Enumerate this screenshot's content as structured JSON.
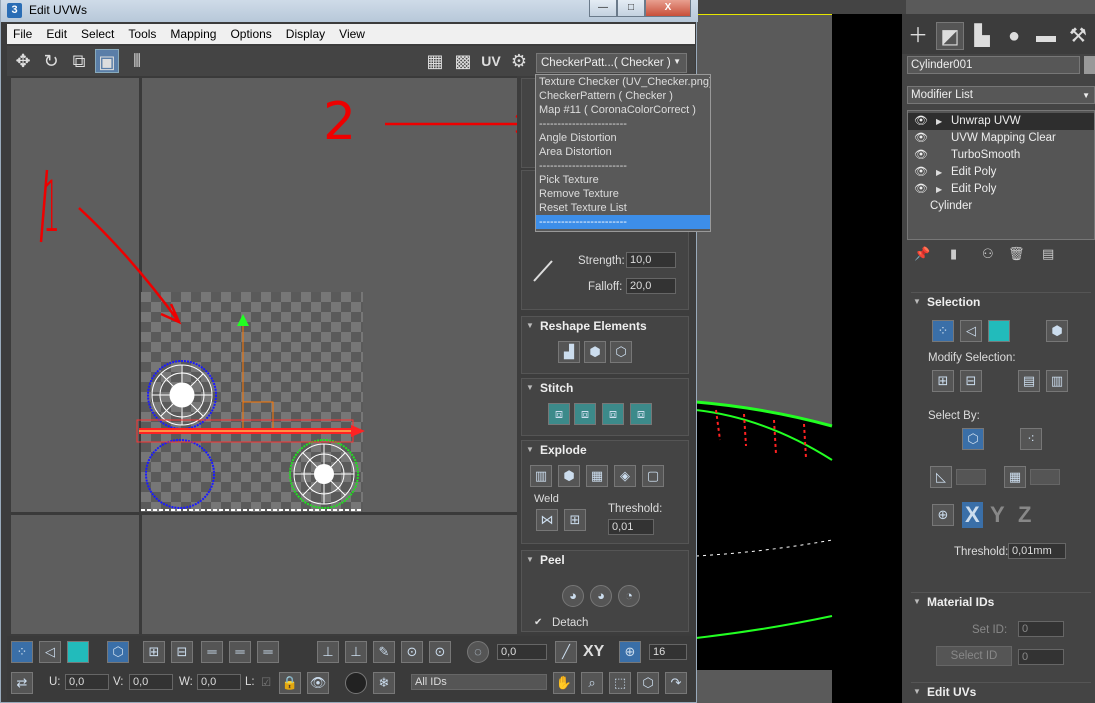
{
  "window": {
    "title": "Edit UVWs",
    "app_icon": "3",
    "controls": {
      "minimize": "—",
      "maximize": "□",
      "close": "X"
    }
  },
  "menu": [
    "File",
    "Edit",
    "Select",
    "Tools",
    "Mapping",
    "Options",
    "Display",
    "View"
  ],
  "toolbar": {
    "uv_label": "UV",
    "texture_dropdown": "CheckerPatt...( Checker )"
  },
  "texture_list": {
    "items": [
      "Texture Checker (UV_Checker.png)",
      "CheckerPattern  ( Checker )",
      "Map #11  ( CoronaColorCorrect )",
      "------------------------",
      "Angle Distortion",
      "Area Distortion",
      "------------------------",
      "Pick Texture",
      "Remove Texture",
      "Reset Texture List",
      "------------------------"
    ]
  },
  "annotations": {
    "one": "1",
    "two": "2"
  },
  "rollouts": {
    "soft": {
      "strength_label": "Strength:",
      "strength_value": "10,0",
      "falloff_label": "Falloff:",
      "falloff_value": "20,0"
    },
    "reshape": {
      "title": "Reshape Elements"
    },
    "stitch": {
      "title": "Stitch"
    },
    "explode": {
      "title": "Explode",
      "weld_label": "Weld",
      "threshold_label": "Threshold:",
      "threshold_value": "0,01"
    },
    "peel": {
      "title": "Peel",
      "detach_label": "Detach"
    }
  },
  "bottom": {
    "spin_value": "0,0",
    "xy_label": "XY",
    "grid_value": "16",
    "u_label": "U:",
    "u_value": "0,0",
    "v_label": "V:",
    "v_value": "0,0",
    "w_label": "W:",
    "w_value": "0,0",
    "l_label": "L:",
    "ids_dropdown": "All IDs"
  },
  "command_panel": {
    "object_name": "Cylinder001",
    "modifier_list": "Modifier List",
    "stack": [
      {
        "name": "Unwrap UVW",
        "eye": true,
        "arrow": true,
        "selected": true
      },
      {
        "name": "UVW Mapping Clear",
        "eye": true,
        "arrow": false,
        "selected": false
      },
      {
        "name": "TurboSmooth",
        "eye": true,
        "arrow": false,
        "selected": false
      },
      {
        "name": "Edit Poly",
        "eye": true,
        "arrow": true,
        "selected": false
      },
      {
        "name": "Edit Poly",
        "eye": true,
        "arrow": true,
        "selected": false
      },
      {
        "name": "Cylinder",
        "eye": false,
        "arrow": false,
        "selected": false
      }
    ],
    "selection": {
      "title": "Selection",
      "modify_label": "Modify Selection:",
      "select_by_label": "Select By:",
      "threshold_label": "Threshold:",
      "threshold_value": "0,01mm",
      "axes": [
        "X",
        "Y",
        "Z"
      ]
    },
    "material_ids": {
      "title": "Material IDs",
      "set_id_label": "Set ID:",
      "set_id_value": "0",
      "select_id_button": "Select ID",
      "select_id_value": "0"
    },
    "edit_uvs": {
      "title": "Edit UVs"
    }
  },
  "colors": {
    "accent": "#3d8ee8",
    "uv_red": "#ff2020",
    "uv_blue": "#1a1aff",
    "uv_green": "#22dd22",
    "uv_white": "#ffffff"
  }
}
